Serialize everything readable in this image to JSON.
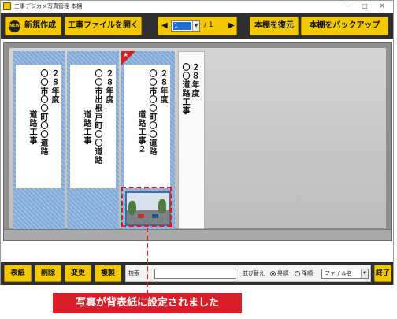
{
  "window": {
    "title": "工事デジカメ写真管理 本棚",
    "controls": {
      "minimize": "—",
      "maximize": "□",
      "close": "✕"
    }
  },
  "toolbar": {
    "new_badge": "NEW",
    "new_label": "新規作成",
    "open_label": "工事ファイルを開く",
    "restore_label": "本棚を復元",
    "backup_label": "本棚をバックアップ",
    "pager": {
      "prev": "◀",
      "next": "▶",
      "current": "1",
      "total": "/ 1",
      "drop": "▼"
    }
  },
  "shelf": {
    "binders": [
      {
        "year": "２８年度",
        "title": "〇〇市〇〇町〇〇道路",
        "project": "道路工事"
      },
      {
        "year": "２８年度",
        "title": "〇〇市出根戸町〇〇道路",
        "project": "道路工事"
      },
      {
        "year": "２８年度",
        "title": "〇〇市〇〇町〇〇道路",
        "project": "道路工事２",
        "ribbon": "★"
      },
      {
        "year": "２８年度",
        "title": "〇〇道路工事"
      }
    ]
  },
  "bottombar": {
    "cover_label": "表紙",
    "delete_label": "削除",
    "change_label": "変更",
    "copy_label": "複製",
    "search_label": "検索",
    "search_value": "",
    "sort_label": "並び替え",
    "asc_label": "昇順",
    "desc_label": "降順",
    "sort_field": "ファイル名",
    "sort_drop": "▼",
    "exit_label": "終了"
  },
  "callout": {
    "text": "写真が背表紙に設定されました"
  },
  "colors": {
    "accent": "#f4c800",
    "toolbar": "#2f2f2f",
    "callout": "#d81e28",
    "binder": "#8fb3dd"
  }
}
